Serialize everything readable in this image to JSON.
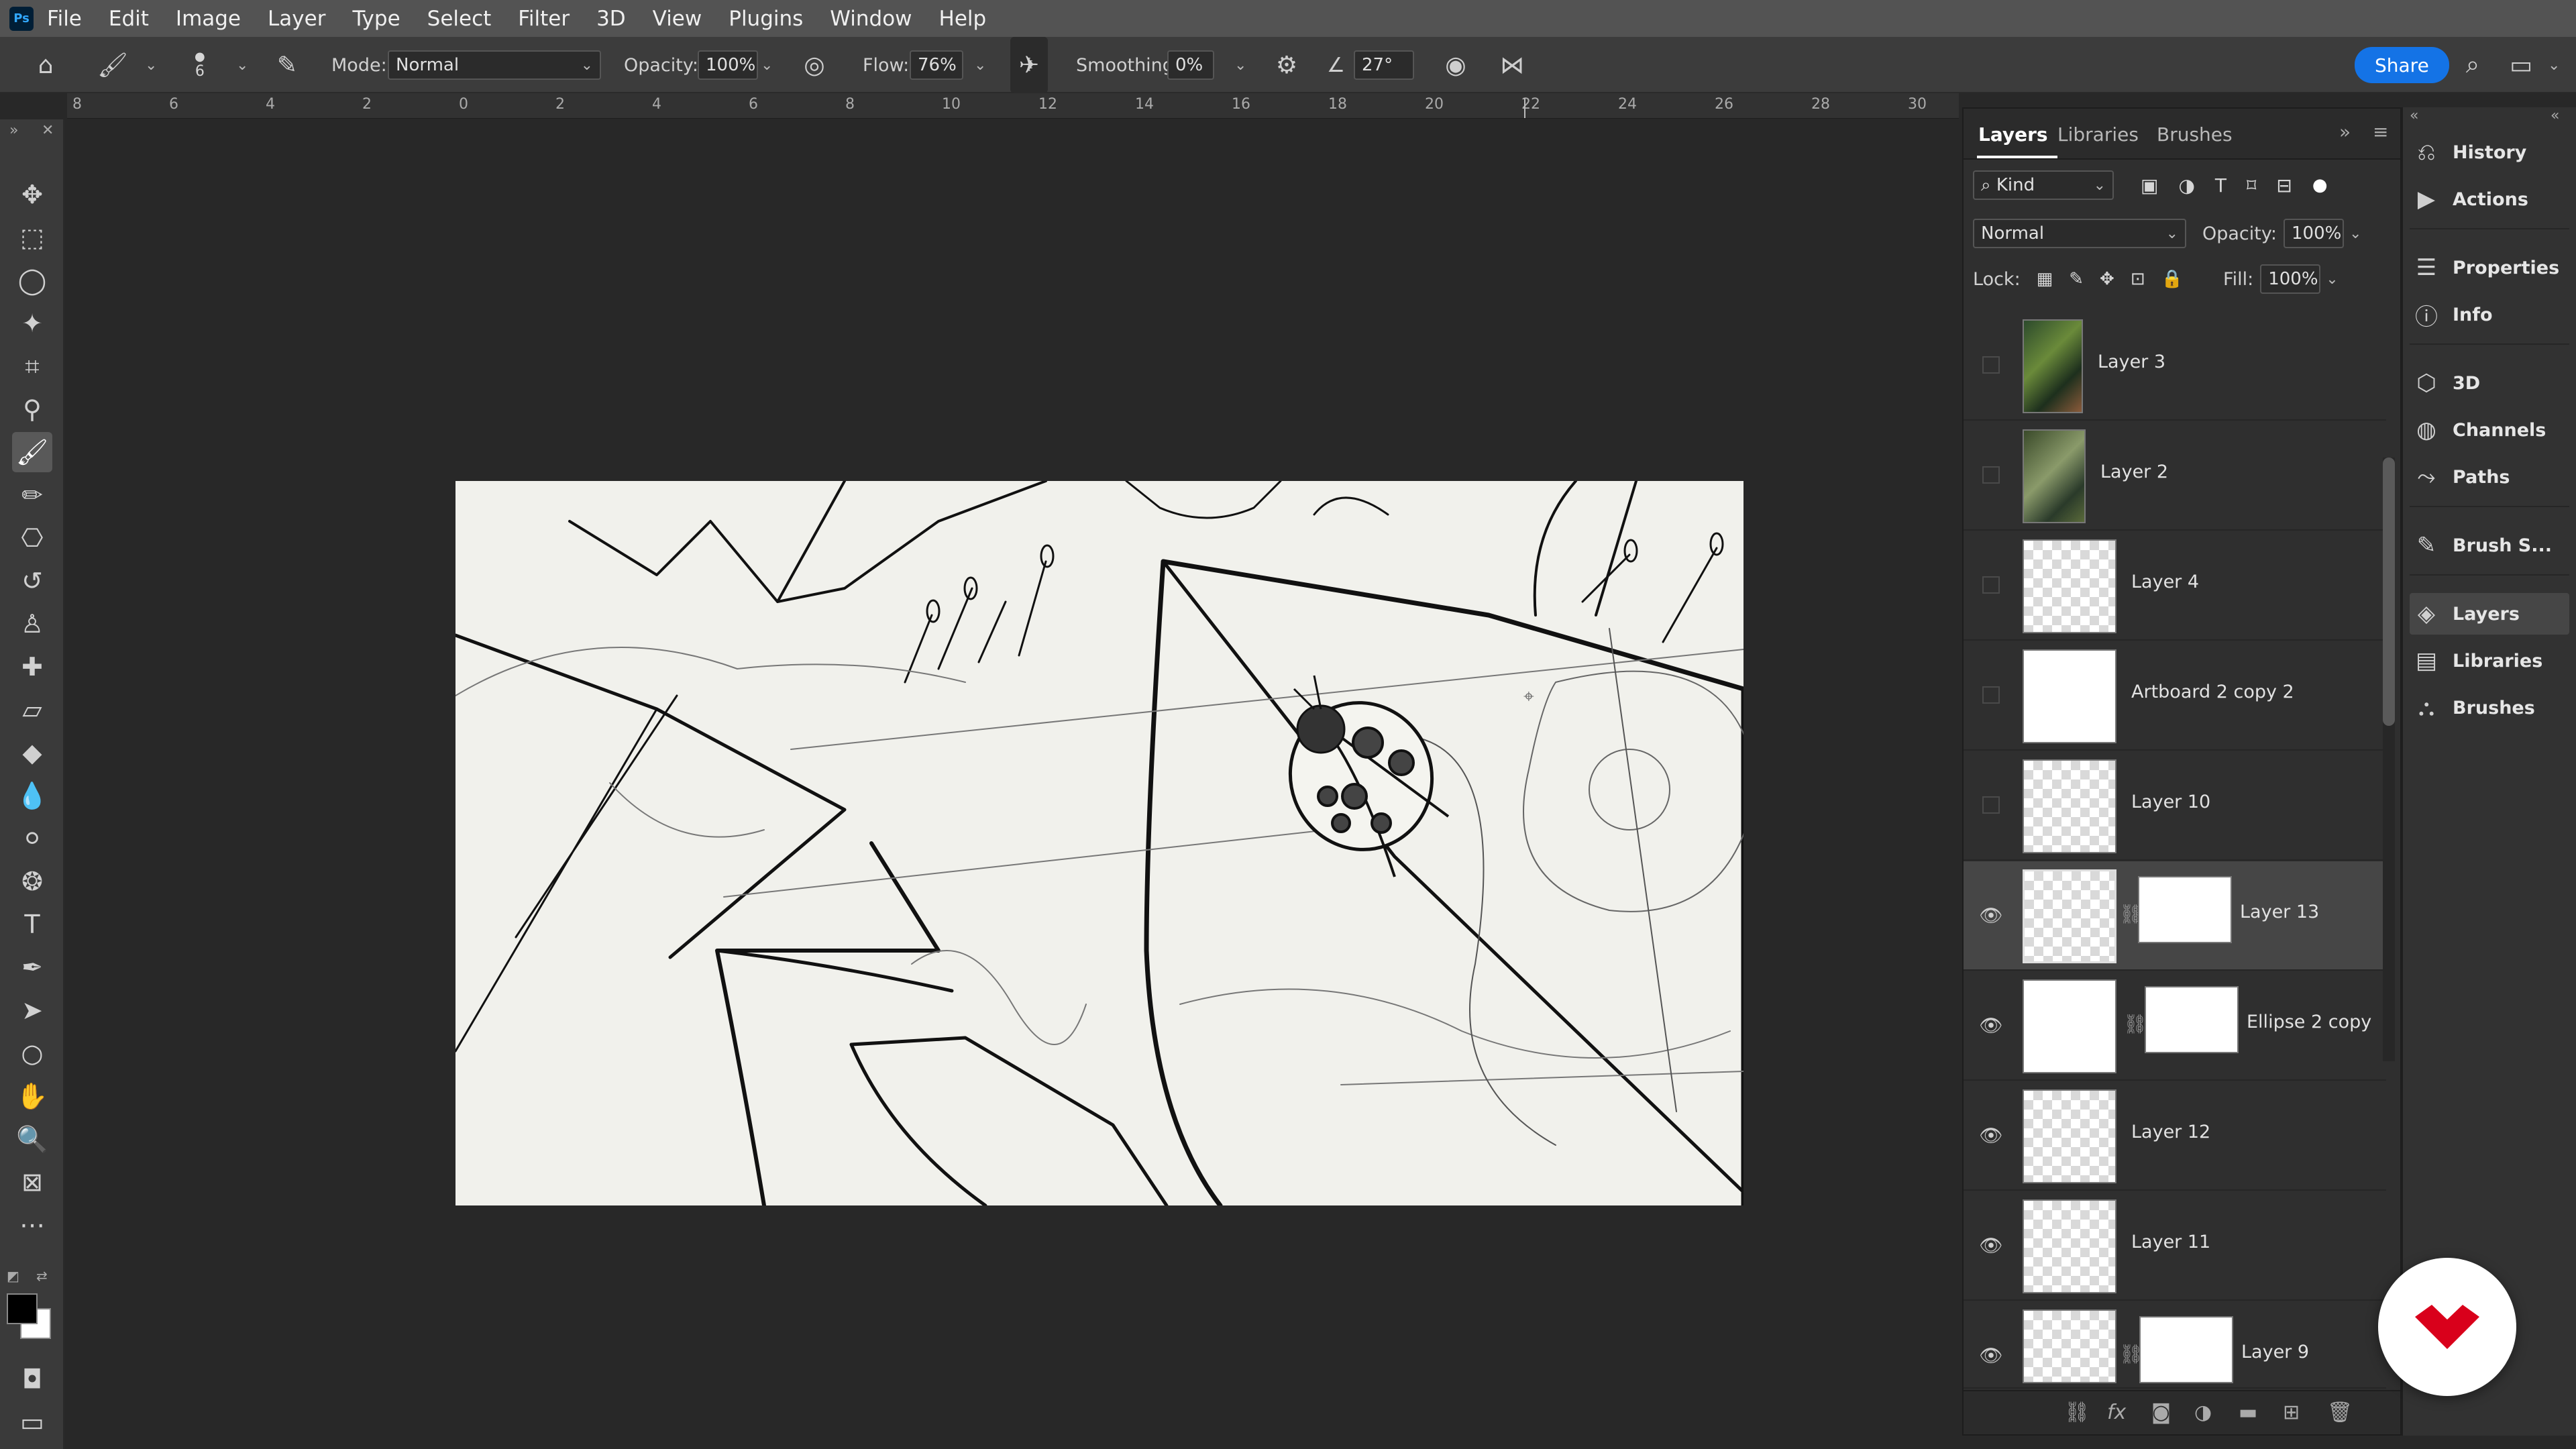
{
  "menu": [
    "File",
    "Edit",
    "Image",
    "Layer",
    "Type",
    "Select",
    "Filter",
    "3D",
    "View",
    "Plugins",
    "Window",
    "Help"
  ],
  "options": {
    "brush_size": "6",
    "mode_label": "Mode:",
    "mode_value": "Normal",
    "opacity_label": "Opacity:",
    "opacity_value": "100%",
    "flow_label": "Flow:",
    "flow_value": "76%",
    "smoothing_label": "Smoothing:",
    "smoothing_value": "0%",
    "angle_value": "27°",
    "share_label": "Share"
  },
  "ruler": [
    "8",
    "6",
    "4",
    "2",
    "0",
    "2",
    "4",
    "6",
    "8",
    "10",
    "12",
    "14",
    "16",
    "18",
    "20",
    "22",
    "24",
    "26",
    "28",
    "30"
  ],
  "layers_panel": {
    "tabs": [
      "Layers",
      "Libraries",
      "Brushes"
    ],
    "filter_kind": "Kind",
    "blend_mode": "Normal",
    "opacity_label": "Opacity:",
    "opacity_value": "100%",
    "lock_label": "Lock:",
    "fill_label": "Fill:",
    "fill_value": "100%",
    "layers": [
      {
        "name": "Layer 3"
      },
      {
        "name": "Layer 2"
      },
      {
        "name": "Layer 4"
      },
      {
        "name": "Artboard 2 copy 2"
      },
      {
        "name": "Layer 10"
      },
      {
        "name": "Layer 13"
      },
      {
        "name": "Ellipse 2 copy"
      },
      {
        "name": "Layer 12"
      },
      {
        "name": "Layer 11"
      },
      {
        "name": "Layer 9"
      }
    ]
  },
  "dock": [
    "History",
    "Actions",
    "Properties",
    "Info",
    "3D",
    "Channels",
    "Paths",
    "Brush S...",
    "Layers",
    "Libraries",
    "Brushes"
  ],
  "colors": {
    "accent": "#1473e6",
    "brand_red": "#d9001b"
  }
}
